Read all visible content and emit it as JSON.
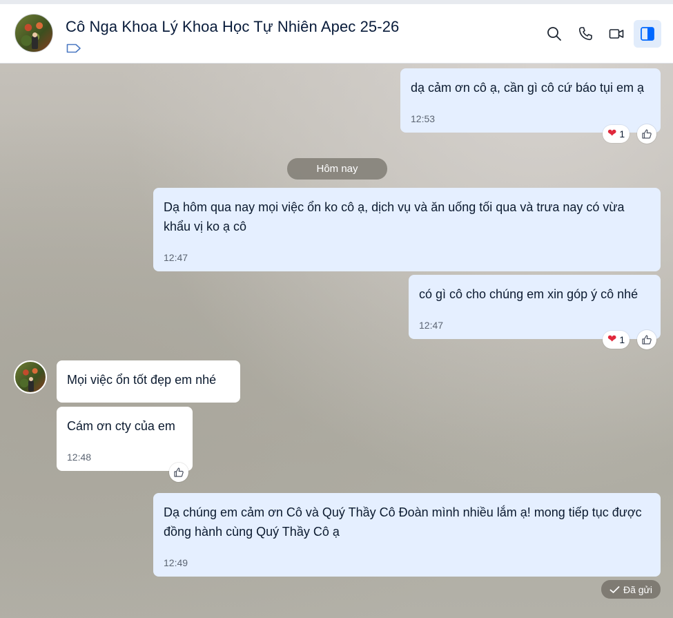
{
  "header": {
    "title": "Cô Nga Khoa Lý Khoa Học Tự Nhiên Apec 25-26",
    "icons": [
      "search-icon",
      "phone-icon",
      "video-icon",
      "sidebar-toggle-icon"
    ]
  },
  "divider": {
    "date_label": "Hôm nay"
  },
  "messages": [
    {
      "text": "dạ cảm ơn cô ạ, cần gì cô cứ báo tụi em ạ",
      "time": "12:53",
      "sender": "me",
      "reaction_count": "1"
    },
    {
      "text": "Dạ hôm qua nay mọi việc ổn ko cô ạ, dịch vụ và ăn uống tối qua và trưa nay có vừa khẩu vị ko ạ cô",
      "time": "12:47",
      "sender": "me"
    },
    {
      "text": "có gì cô cho chúng em xin góp ý cô nhé",
      "time": "12:47",
      "sender": "me",
      "reaction_count": "1"
    },
    {
      "text": "Mọi việc ổn tốt đẹp em nhé",
      "sender": "them"
    },
    {
      "text": "Cám ơn cty của em",
      "time": "12:48",
      "sender": "them"
    },
    {
      "text": "Dạ chúng em cảm ơn Cô và Quý Thầy Cô Đoàn mình nhiều lắm ạ! mong tiếp tục được đồng hành cùng Quý Thầy Cô ạ",
      "time": "12:49",
      "sender": "me"
    }
  ],
  "status": {
    "sent_label": "Đã gửi"
  },
  "colors": {
    "my_bubble": "#e5efff",
    "their_bubble": "#ffffff",
    "accent": "#0068ff",
    "heart": "#e0283b"
  }
}
